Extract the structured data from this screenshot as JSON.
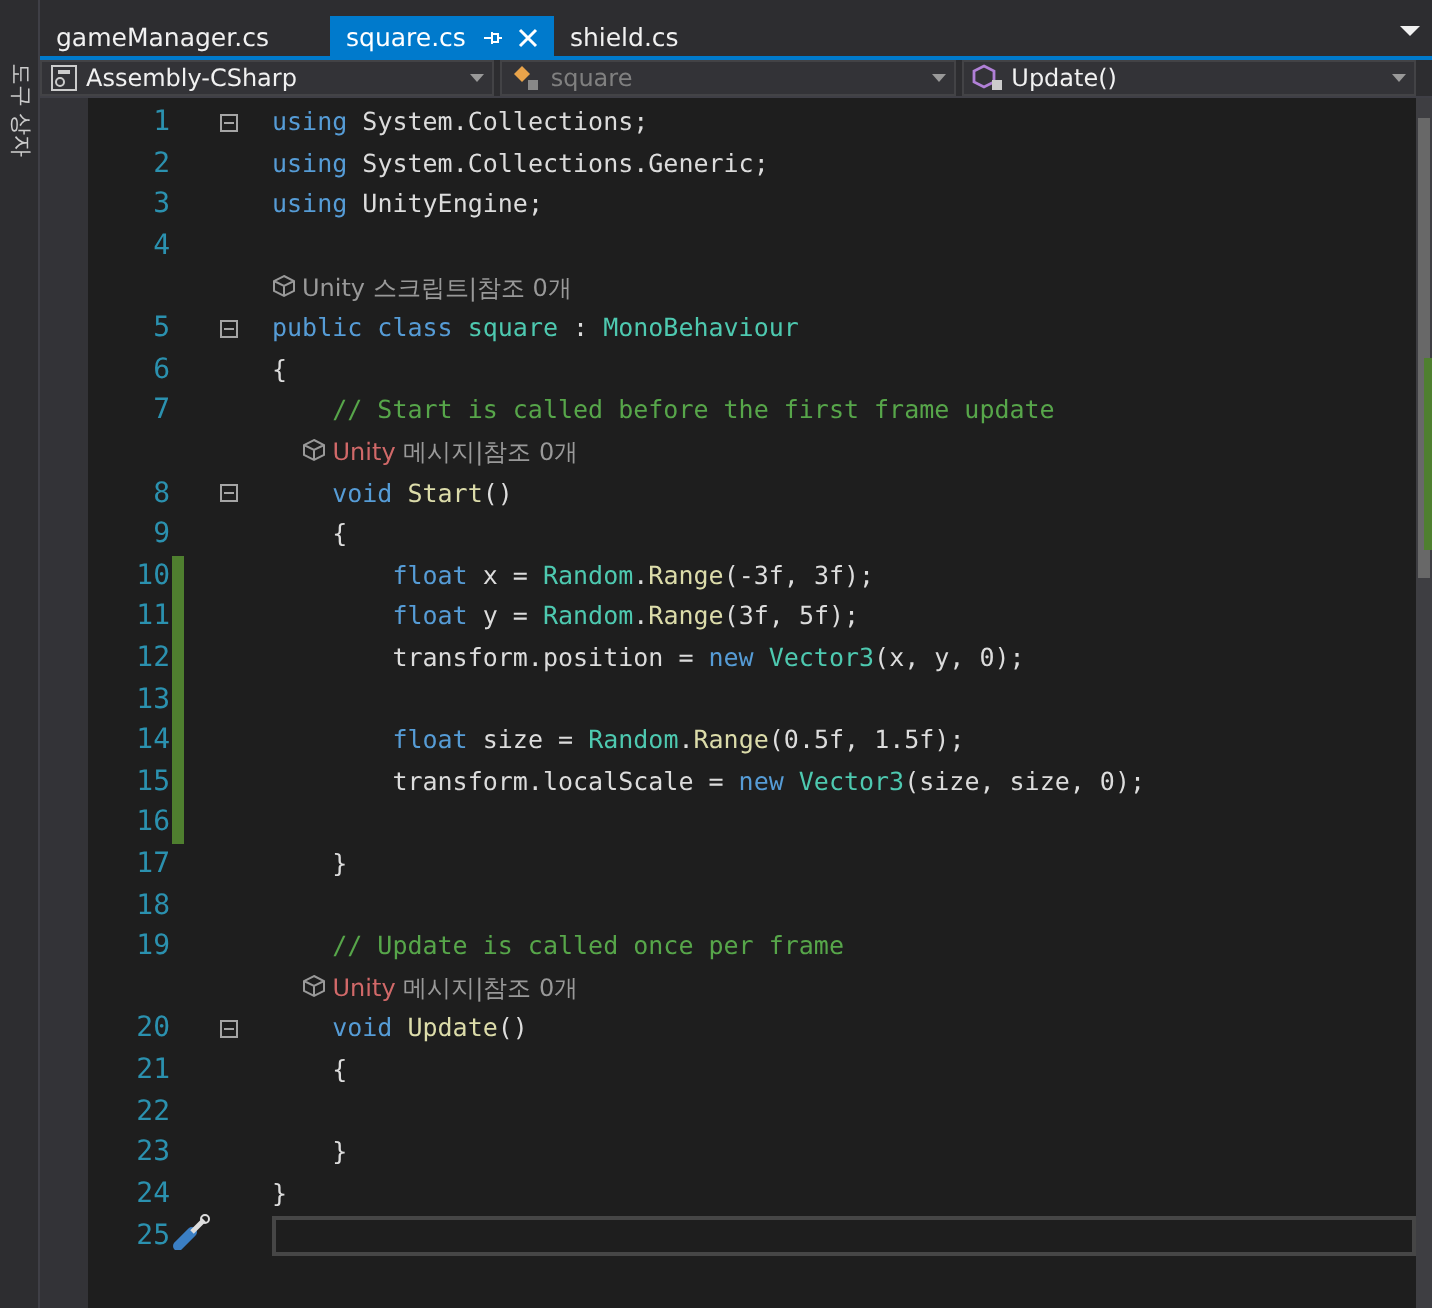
{
  "toolbox": {
    "label": "도구 상자"
  },
  "tabs": [
    {
      "label": "gameManager.cs",
      "selected": false,
      "pinned": false
    },
    {
      "label": "square.cs",
      "selected": true,
      "pinned": true
    },
    {
      "label": "shield.cs",
      "selected": false,
      "pinned": false
    }
  ],
  "navigation": [
    {
      "kind": "project",
      "label": "Assembly-CSharp",
      "disabled": false
    },
    {
      "kind": "class",
      "label": "square",
      "disabled": true
    },
    {
      "kind": "method",
      "label": "Update()",
      "disabled": false
    }
  ],
  "lines": [
    {
      "kind": "code",
      "number": "1",
      "fold": true,
      "changed": false,
      "tokens": [
        {
          "t": "using",
          "kind": "keyword"
        },
        {
          "t": " System.Collections;",
          "kind": "plain"
        }
      ]
    },
    {
      "kind": "code",
      "number": "2",
      "fold": false,
      "changed": false,
      "tokens": [
        {
          "t": "using",
          "kind": "keyword"
        },
        {
          "t": " System.Collections.Generic;",
          "kind": "plain"
        }
      ]
    },
    {
      "kind": "code",
      "number": "3",
      "fold": false,
      "changed": false,
      "tokens": [
        {
          "t": "using",
          "kind": "keyword"
        },
        {
          "t": " UnityEngine;",
          "kind": "plain"
        }
      ]
    },
    {
      "kind": "code",
      "number": "4",
      "fold": false,
      "changed": false
    },
    {
      "kind": "codelens",
      "tokens": [
        {
          "t": "Unity 스크립트|참조 0개",
          "kind": "lens"
        }
      ]
    },
    {
      "kind": "code",
      "number": "5",
      "fold": true,
      "changed": false,
      "tokens": [
        {
          "t": "public class ",
          "kind": "keyword"
        },
        {
          "t": "square",
          "kind": "type"
        },
        {
          "t": " : ",
          "kind": "plain"
        },
        {
          "t": "MonoBehaviour",
          "kind": "type"
        }
      ]
    },
    {
      "kind": "code",
      "number": "6",
      "fold": false,
      "changed": false,
      "tokens": [
        {
          "t": "{",
          "kind": "brace"
        }
      ]
    },
    {
      "kind": "code",
      "number": "7",
      "fold": false,
      "changed": false,
      "tokens": [
        {
          "t": "    // Start is called before the first frame update",
          "kind": "comment"
        }
      ]
    },
    {
      "kind": "codelens",
      "tokens": [
        {
          "t": "    Unity",
          "kind": "unity"
        },
        {
          "t": " 메시지|참조 0개",
          "kind": "lens"
        }
      ]
    },
    {
      "kind": "code",
      "number": "8",
      "fold": true,
      "changed": false,
      "tokens": [
        {
          "t": "    void ",
          "kind": "keyword"
        },
        {
          "t": "Start",
          "kind": "method"
        },
        {
          "t": "()",
          "kind": "plain"
        }
      ]
    },
    {
      "kind": "code",
      "number": "9",
      "fold": false,
      "changed": false,
      "tokens": [
        {
          "t": "    {",
          "kind": "brace"
        }
      ]
    },
    {
      "kind": "code",
      "number": "10",
      "fold": false,
      "changed": true,
      "tokens": [
        {
          "t": "        float",
          "kind": "keyword"
        },
        {
          "t": " x = ",
          "kind": "plain"
        },
        {
          "t": "Random",
          "kind": "type"
        },
        {
          "t": ".",
          "kind": "plain"
        },
        {
          "t": "Range",
          "kind": "method"
        },
        {
          "t": "(-3f, 3f);",
          "kind": "plain"
        }
      ]
    },
    {
      "kind": "code",
      "number": "11",
      "fold": false,
      "changed": true,
      "tokens": [
        {
          "t": "        float",
          "kind": "keyword"
        },
        {
          "t": " y = ",
          "kind": "plain"
        },
        {
          "t": "Random",
          "kind": "type"
        },
        {
          "t": ".",
          "kind": "plain"
        },
        {
          "t": "Range",
          "kind": "method"
        },
        {
          "t": "(3f, 5f);",
          "kind": "plain"
        }
      ]
    },
    {
      "kind": "code",
      "number": "12",
      "fold": false,
      "changed": true,
      "tokens": [
        {
          "t": "        transform.position = ",
          "kind": "plain"
        },
        {
          "t": "new ",
          "kind": "keyword"
        },
        {
          "t": "Vector3",
          "kind": "type"
        },
        {
          "t": "(x, y, 0);",
          "kind": "plain"
        }
      ]
    },
    {
      "kind": "code",
      "number": "13",
      "fold": false,
      "changed": true
    },
    {
      "kind": "code",
      "number": "14",
      "fold": false,
      "changed": true,
      "tokens": [
        {
          "t": "        float",
          "kind": "keyword"
        },
        {
          "t": " size = ",
          "kind": "plain"
        },
        {
          "t": "Random",
          "kind": "type"
        },
        {
          "t": ".",
          "kind": "plain"
        },
        {
          "t": "Range",
          "kind": "method"
        },
        {
          "t": "(0.5f, 1.5f);",
          "kind": "plain"
        }
      ]
    },
    {
      "kind": "code",
      "number": "15",
      "fold": false,
      "changed": true,
      "tokens": [
        {
          "t": "        transform.localScale = ",
          "kind": "plain"
        },
        {
          "t": "new ",
          "kind": "keyword"
        },
        {
          "t": "Vector3",
          "kind": "type"
        },
        {
          "t": "(size, size, 0);",
          "kind": "plain"
        }
      ]
    },
    {
      "kind": "code",
      "number": "16",
      "fold": false,
      "changed": true
    },
    {
      "kind": "code",
      "number": "17",
      "fold": false,
      "changed": false,
      "tokens": [
        {
          "t": "    }",
          "kind": "brace"
        }
      ]
    },
    {
      "kind": "code",
      "number": "18",
      "fold": false,
      "changed": false
    },
    {
      "kind": "code",
      "number": "19",
      "fold": false,
      "changed": false,
      "tokens": [
        {
          "t": "    // Update is called once per frame",
          "kind": "comment"
        }
      ]
    },
    {
      "kind": "codelens",
      "tokens": [
        {
          "t": "    Unity",
          "kind": "unity"
        },
        {
          "t": " 메시지|참조 0개",
          "kind": "lens"
        }
      ]
    },
    {
      "kind": "code",
      "number": "20",
      "fold": true,
      "changed": false,
      "tokens": [
        {
          "t": "    void ",
          "kind": "keyword"
        },
        {
          "t": "Update",
          "kind": "method"
        },
        {
          "t": "()",
          "kind": "plain"
        }
      ]
    },
    {
      "kind": "code",
      "number": "21",
      "fold": false,
      "changed": false,
      "tokens": [
        {
          "t": "    {",
          "kind": "brace"
        }
      ]
    },
    {
      "kind": "code",
      "number": "22",
      "fold": false,
      "changed": false
    },
    {
      "kind": "code",
      "number": "23",
      "fold": false,
      "changed": false,
      "tokens": [
        {
          "t": "    }",
          "kind": "brace"
        }
      ]
    },
    {
      "kind": "code",
      "number": "24",
      "fold": false,
      "changed": false,
      "tokens": [
        {
          "t": "}",
          "kind": "brace"
        }
      ]
    },
    {
      "kind": "code",
      "number": "25",
      "fold": false,
      "changed": false,
      "current": true
    }
  ]
}
